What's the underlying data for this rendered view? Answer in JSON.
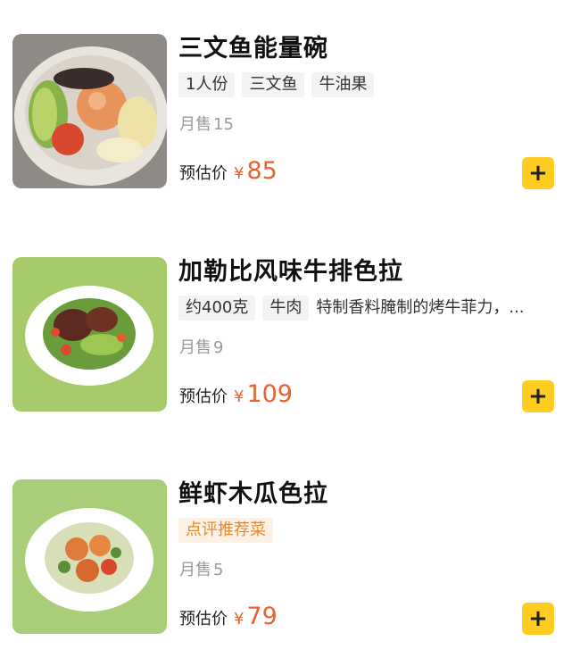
{
  "items": [
    {
      "title": "三文鱼能量碗",
      "tags": [
        "1人份",
        "三文鱼",
        "牛油果"
      ],
      "sales_label": "月售",
      "sales": "15",
      "price_label": "预估价",
      "currency": "¥",
      "price": "85",
      "image_icon": "salmon-poke-bowl"
    },
    {
      "title": "加勒比风味牛排色拉",
      "tags": [
        "约400克",
        "牛肉"
      ],
      "description": "特制香料腌制的烤牛菲力，...",
      "sales_label": "月售",
      "sales": "9",
      "price_label": "预估价",
      "currency": "¥",
      "price": "109",
      "image_icon": "steak-salad"
    },
    {
      "title": "鲜虾木瓜色拉",
      "tags": [
        "点评推荐菜"
      ],
      "sales_label": "月售",
      "sales": "5",
      "price_label": "预估价",
      "currency": "¥",
      "price": "79",
      "image_icon": "shrimp-papaya-salad"
    }
  ],
  "add_button_label": "+",
  "colors": {
    "price": "#e8612e",
    "add_button": "#ffcc22",
    "recommend_tag_text": "#e68a2e",
    "recommend_tag_bg": "#fdf1e3"
  }
}
